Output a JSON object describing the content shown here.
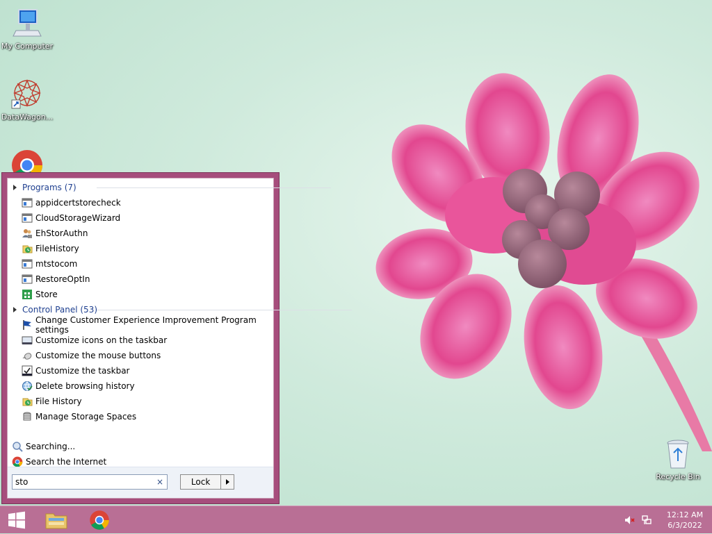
{
  "desktop": {
    "icons": [
      {
        "label": "My Computer"
      },
      {
        "label": "DataWagon..."
      },
      {
        "label": ""
      },
      {
        "label": "Recycle Bin"
      }
    ]
  },
  "start_menu": {
    "groups": [
      {
        "title": "Programs (7)",
        "items": [
          {
            "label": "appidcertstorecheck",
            "icon": "app-window-icon"
          },
          {
            "label": "CloudStorageWizard",
            "icon": "app-window-icon"
          },
          {
            "label": "EhStorAuthn",
            "icon": "users-icon"
          },
          {
            "label": "FileHistory",
            "icon": "file-history-icon"
          },
          {
            "label": "mtstocom",
            "icon": "app-window-icon"
          },
          {
            "label": "RestoreOptIn",
            "icon": "app-window-icon"
          },
          {
            "label": "Store",
            "icon": "store-icon"
          }
        ]
      },
      {
        "title": "Control Panel (53)",
        "items": [
          {
            "label": "Change Customer Experience Improvement Program settings",
            "icon": "flag-icon"
          },
          {
            "label": "Customize icons on the taskbar",
            "icon": "taskbar-icon"
          },
          {
            "label": "Customize the mouse buttons",
            "icon": "mouse-icon"
          },
          {
            "label": "Customize the taskbar",
            "icon": "taskbar-check-icon"
          },
          {
            "label": "Delete browsing history",
            "icon": "internet-options-icon"
          },
          {
            "label": "File History",
            "icon": "file-history-icon"
          },
          {
            "label": "Manage Storage Spaces",
            "icon": "storage-spaces-icon"
          }
        ]
      }
    ],
    "searching_label": "Searching...",
    "search_internet_label": "Search the Internet",
    "search_value": "sto",
    "clear_symbol": "×",
    "lock_label": "Lock"
  },
  "taskbar": {
    "time": "12:12 AM",
    "date": "6/3/2022"
  },
  "colors": {
    "menu_frame": "#a64d7c",
    "taskbar": "#b96f95",
    "group_header": "#1e3f8f"
  }
}
